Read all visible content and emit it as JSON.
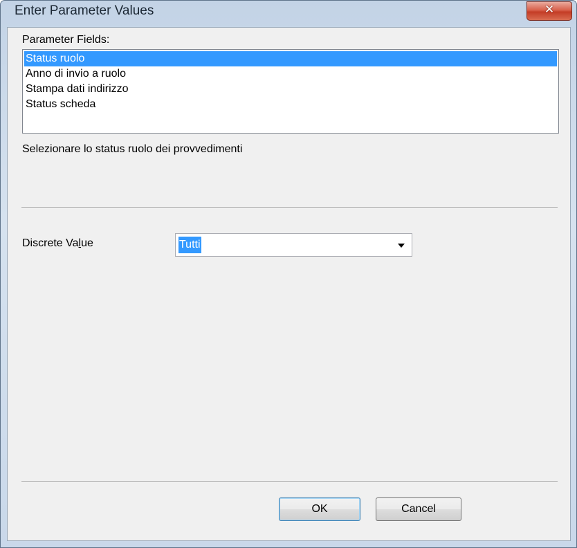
{
  "window": {
    "title": "Enter Parameter Values",
    "close_glyph": "✕"
  },
  "parameter_fields": {
    "label": "Parameter Fields:",
    "items": [
      {
        "label": "Status ruolo",
        "selected": true
      },
      {
        "label": "Anno di invio a ruolo",
        "selected": false
      },
      {
        "label": "Stampa dati indirizzo",
        "selected": false
      },
      {
        "label": "Status scheda",
        "selected": false
      }
    ]
  },
  "description": "Selezionare lo status ruolo dei provvedimenti",
  "discrete_value": {
    "label_before": "Discrete Va",
    "label_accel": "l",
    "label_after": "ue",
    "value": "Tutti"
  },
  "buttons": {
    "ok": "OK",
    "cancel": "Cancel"
  },
  "colors": {
    "selection": "#3399ff",
    "close_button": "#c43c26",
    "dialog_background": "#f0f0f0"
  }
}
